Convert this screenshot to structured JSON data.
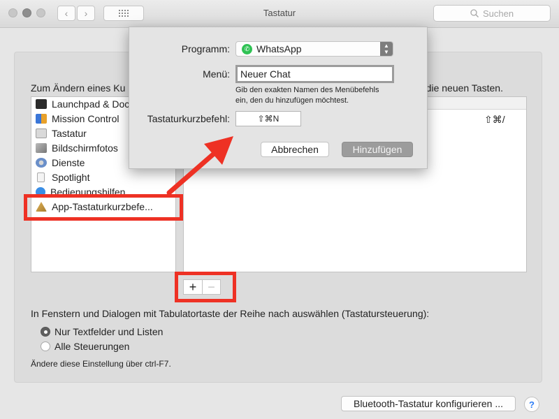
{
  "window": {
    "title": "Tastatur",
    "search_placeholder": "Suchen"
  },
  "main": {
    "intro_left": "Zum Ändern eines Ku",
    "intro_right": "e die neuen Tasten.",
    "list_items": [
      {
        "label": "Launchpad & Doc",
        "icon": "launchpad-icon"
      },
      {
        "label": "Mission Control",
        "icon": "mission-control-icon"
      },
      {
        "label": "Tastatur",
        "icon": "keyboard-icon"
      },
      {
        "label": "Bildschirmfotos",
        "icon": "screenshot-icon"
      },
      {
        "label": "Dienste",
        "icon": "gear-icon"
      },
      {
        "label": "Spotlight",
        "icon": "spotlight-icon"
      },
      {
        "label": "Bedienungshilfen",
        "icon": "accessibility-icon"
      },
      {
        "label": "App-Tastaturkurzbefe...",
        "icon": "app-shortcuts-icon"
      }
    ],
    "shortcut_value": "⇧⌘/",
    "plus_label": "+",
    "minus_label": "−",
    "tab_navigation_label": "In Fenstern und Dialogen mit Tabulatortaste der Reihe nach auswählen (Tastatursteuerung):",
    "radio_options": [
      {
        "label": "Nur Textfelder und Listen",
        "selected": true
      },
      {
        "label": "Alle Steuerungen",
        "selected": false
      }
    ],
    "hint": "Ändere diese Einstellung über ctrl-F7.",
    "bluetooth_button": "Bluetooth-Tastatur konfigurieren ...",
    "help_label": "?"
  },
  "dialog": {
    "program_label": "Programm:",
    "program_value": "WhatsApp",
    "menu_label": "Menü:",
    "menu_value": "Neuer Chat",
    "menu_help_line1": "Gib den exakten Namen des Menübefehls",
    "menu_help_line2": "ein, den du hinzufügen möchtest.",
    "shortcut_label": "Tastaturkurzbefehl:",
    "shortcut_value": "⇧⌘N",
    "cancel_button": "Abbrechen",
    "add_button": "Hinzufügen"
  },
  "colors": {
    "annotation_red": "#ee3124",
    "whatsapp_green": "#2fc254",
    "help_blue": "#2d7cf6"
  }
}
